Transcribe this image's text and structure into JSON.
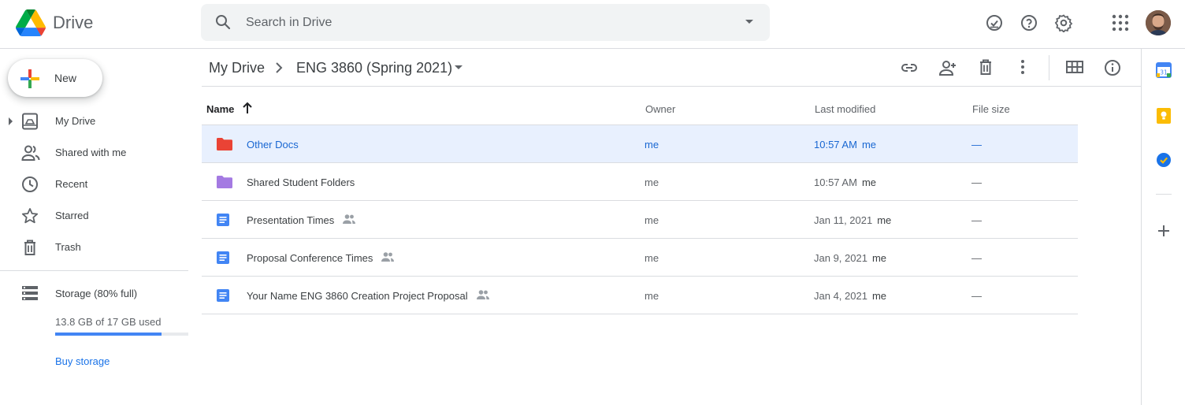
{
  "app": {
    "name": "Drive"
  },
  "search": {
    "placeholder": "Search in Drive"
  },
  "nav": {
    "new_label": "New",
    "items": [
      {
        "label": "My Drive",
        "icon": "my-drive-icon"
      },
      {
        "label": "Shared with me",
        "icon": "people-icon"
      },
      {
        "label": "Recent",
        "icon": "clock-icon"
      },
      {
        "label": "Starred",
        "icon": "star-icon"
      },
      {
        "label": "Trash",
        "icon": "trash-icon"
      }
    ],
    "storage": {
      "title": "Storage (80% full)",
      "used_text": "13.8 GB of 17 GB used",
      "fraction": 0.8,
      "buy_label": "Buy storage"
    }
  },
  "breadcrumb": {
    "root": "My Drive",
    "current": "ENG 3860 (Spring 2021)"
  },
  "table": {
    "headers": {
      "name": "Name",
      "owner": "Owner",
      "modified": "Last modified",
      "size": "File size"
    },
    "rows": [
      {
        "name": "Other Docs",
        "type": "folder",
        "color": "#ea4335",
        "shared": false,
        "owner": "me",
        "modified": "10:57 AM",
        "by": "me",
        "size": "—",
        "selected": true
      },
      {
        "name": "Shared Student Folders",
        "type": "folder",
        "color": "#a47ae2",
        "shared": false,
        "owner": "me",
        "modified": "10:57 AM",
        "by": "me",
        "size": "—",
        "selected": false
      },
      {
        "name": "Presentation Times",
        "type": "doc",
        "color": "#4285f4",
        "shared": true,
        "owner": "me",
        "modified": "Jan 11, 2021",
        "by": "me",
        "size": "—",
        "selected": false
      },
      {
        "name": "Proposal Conference Times",
        "type": "doc",
        "color": "#4285f4",
        "shared": true,
        "owner": "me",
        "modified": "Jan 9, 2021",
        "by": "me",
        "size": "—",
        "selected": false
      },
      {
        "name": "Your Name ENG 3860 Creation Project Proposal",
        "type": "doc",
        "color": "#4285f4",
        "shared": true,
        "owner": "me",
        "modified": "Jan 4, 2021",
        "by": "me",
        "size": "—",
        "selected": false
      }
    ]
  },
  "colors": {
    "accent": "#1a73e8",
    "selected_row": "#e8f0fe",
    "storage_fill": "#4285f4"
  }
}
